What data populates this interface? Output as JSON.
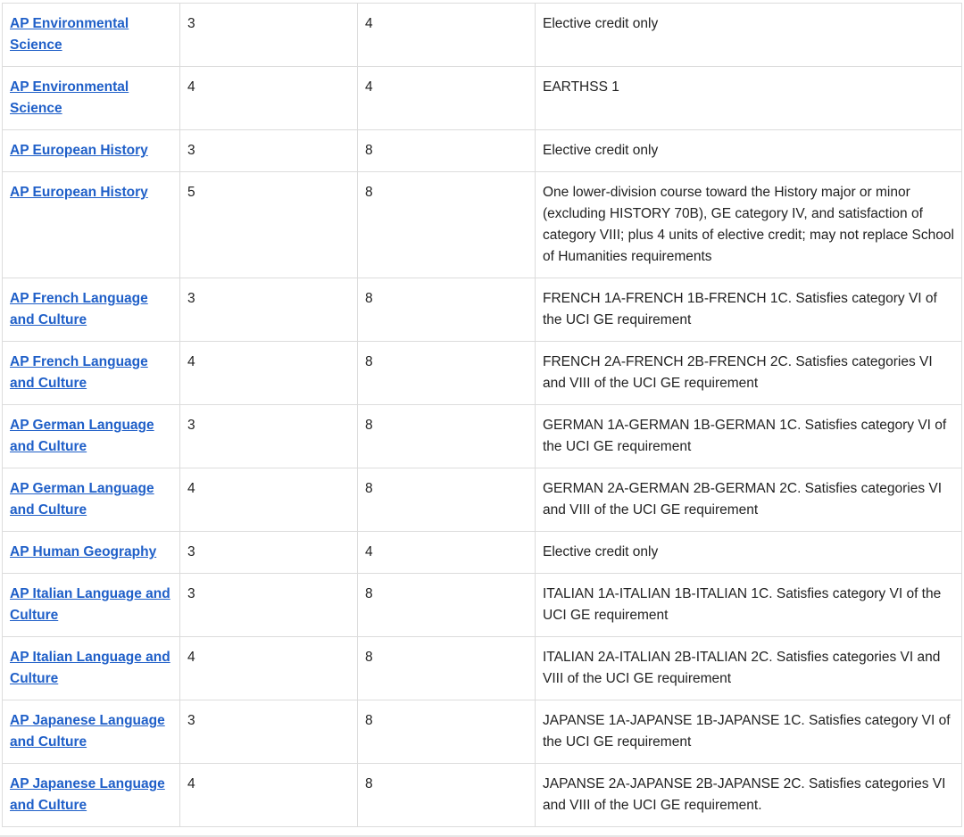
{
  "rows": [
    {
      "exam": "AP Environmental Science",
      "score": "3",
      "units": "4",
      "credit": "Elective credit only"
    },
    {
      "exam": "AP Environmental Science",
      "score": "4",
      "units": "4",
      "credit": "EARTHSS 1"
    },
    {
      "exam": "AP European History",
      "score": "3",
      "units": "8",
      "credit": "Elective credit only"
    },
    {
      "exam": "AP European History",
      "score": "5",
      "units": "8",
      "credit": "One lower-division course toward the History major or minor (excluding HISTORY 70B), GE category IV, and satisfaction of category VIII; plus 4 units of elective credit; may not replace School of Humanities requirements"
    },
    {
      "exam": "AP French Language and Culture",
      "score": "3",
      "units": "8",
      "credit": "FRENCH 1A-FRENCH 1B-FRENCH 1C. Satisfies category VI of the UCI GE requirement"
    },
    {
      "exam": "AP French Language and Culture",
      "score": "4",
      "units": "8",
      "credit": "FRENCH 2A-FRENCH 2B-FRENCH 2C. Satisfies categories VI and VIII of the UCI GE requirement"
    },
    {
      "exam": "AP German Language and Culture",
      "score": "3",
      "units": "8",
      "credit": "GERMAN 1A-GERMAN 1B-GERMAN 1C. Satisfies category VI of the UCI GE requirement"
    },
    {
      "exam": "AP German Language and Culture",
      "score": "4",
      "units": "8",
      "credit": "GERMAN 2A-GERMAN 2B-GERMAN 2C. Satisfies categories VI and VIII of the UCI GE requirement"
    },
    {
      "exam": "AP Human Geography",
      "score": "3",
      "units": "4",
      "credit": "Elective credit only"
    },
    {
      "exam": "AP Italian Language and Culture",
      "score": "3",
      "units": "8",
      "credit": "ITALIAN 1A-ITALIAN 1B-ITALIAN 1C. Satisfies category VI of the UCI GE requirement"
    },
    {
      "exam": "AP Italian Language and Culture",
      "score": "4",
      "units": "8",
      "credit": "ITALIAN 2A-ITALIAN 2B-ITALIAN 2C. Satisfies categories VI and VIII of the UCI GE requirement"
    },
    {
      "exam": "AP Japanese Language and Culture",
      "score": "3",
      "units": "8",
      "credit": "JAPANSE 1A-JAPANSE 1B-JAPANSE 1C. Satisfies category VI of the UCI GE requirement"
    },
    {
      "exam": "AP Japanese Language and Culture",
      "score": "4",
      "units": "8",
      "credit": "JAPANSE 2A-JAPANSE 2B-JAPANSE 2C. Satisfies categories VI and VIII of the UCI GE requirement."
    }
  ]
}
